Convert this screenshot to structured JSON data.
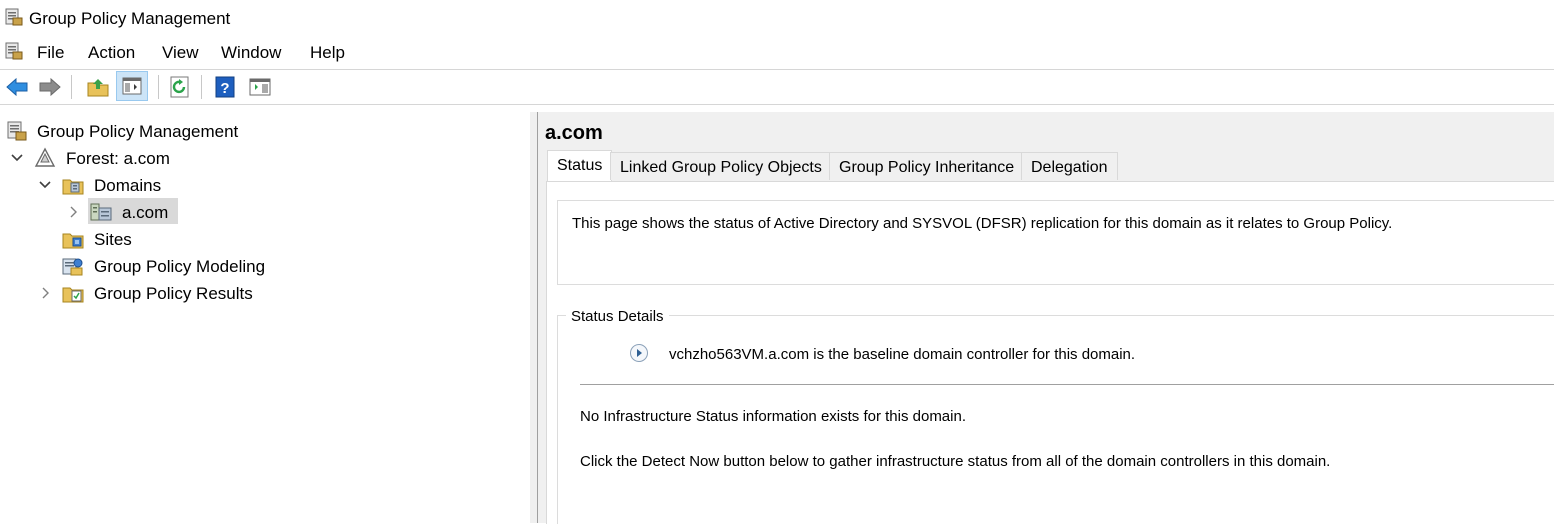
{
  "window": {
    "title": "Group Policy Management"
  },
  "menu": [
    "File",
    "Action",
    "View",
    "Window",
    "Help"
  ],
  "toolbar": {
    "buttons": [
      "back-arrow-icon",
      "forward-arrow-icon",
      "up-folder-icon",
      "show-hide-tree-icon",
      "refresh-icon",
      "help-icon",
      "show-action-pane-icon"
    ]
  },
  "tree": {
    "root": "Group Policy Management",
    "forest": "Forest: a.com",
    "domains": "Domains",
    "domain": "a.com",
    "sites": "Sites",
    "modeling": "Group Policy Modeling",
    "results": "Group Policy Results"
  },
  "detail": {
    "title": "a.com",
    "tabs": [
      "Status",
      "Linked Group Policy Objects",
      "Group Policy Inheritance",
      "Delegation"
    ],
    "active_tab": "Status",
    "info": "This page shows the status of Active Directory and SYSVOL (DFSR) replication for this domain as it relates to Group Policy.",
    "status_details_label": "Status Details",
    "baseline": "vchzho563VM.a.com is the baseline domain controller for this domain.",
    "no_infra": "No Infrastructure Status information exists for this domain.",
    "detect_hint": "Click the Detect Now button below to gather infrastructure status from all of the domain controllers in this domain."
  },
  "colors": {
    "accent_blue": "#1e73be",
    "selection": "#d9d9d9",
    "pane_bg": "#f0f0f0"
  }
}
